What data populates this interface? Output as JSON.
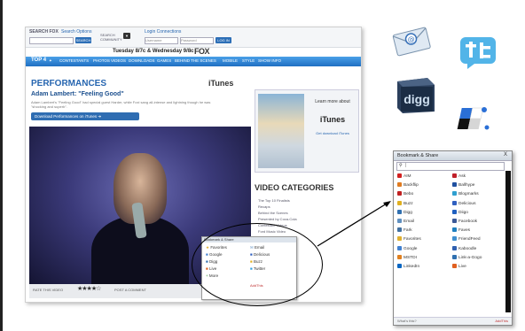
{
  "screenshot": {
    "topbar": {
      "search_label": "SEARCH FOX",
      "search_sub": "Search Options",
      "search_btn": "SEARCH",
      "community_label": "SEARCH COMMUNITY",
      "login_label": "Login Connections",
      "username_placeholder": "Username",
      "password_placeholder": "Password",
      "login_btn": "LOG IN"
    },
    "date_line": "Tuesday 8/7c & Wednesday 9/8c",
    "network_logo": "FOX",
    "nav": {
      "logo": "TOP 4",
      "items": [
        "CONTESTANTS",
        "PHOTOS",
        "VIDEOS",
        "DOWNLOADS",
        "GAMES",
        "BEHIND THE SCENES",
        "MOBILE",
        "STYLE",
        "SHOW INFO"
      ]
    },
    "section_title": "PERFORMANCES",
    "itunes_header": "iTunes",
    "song_title": "Adam Lambert: \"Feeling Good\"",
    "description": "Adam Lambert's \"Feeling Good\" had special guest Harder, while Foxi sang all-intense and lightning though he was \"shocking and superb\".",
    "download_button": "Download Performances on iTunes",
    "video_controls": {
      "rate_label": "RATE THIS VIDEO",
      "stars": "★★★★☆",
      "post_comment": "POST A COMMENT",
      "share": "SHARE THIS"
    },
    "ad": {
      "learn_more": "Learn more about",
      "itunes": "iTunes",
      "download": "Get download iTunes"
    },
    "video_categories_title": "VIDEO CATEGORIES",
    "video_categories": [
      "The Top 10 Finalists",
      "Recaps",
      "Behind the Scenes",
      "Presented by Coca-Cola",
      "Contestant Videos",
      "Ford Music Video",
      "Audition",
      "The Remaining Top 13",
      "Top 36 Semi-Finals"
    ],
    "mini_menu": {
      "header": "Bookmark & Share",
      "items": [
        "Favorites",
        "Email",
        "Google",
        "Delicious",
        "Digg",
        "Buzz",
        "Live",
        "Twitter",
        "More"
      ],
      "footer": "AddThis"
    }
  },
  "bookmark_panel": {
    "title": "Bookmark & Share",
    "close": "X",
    "search_value": "",
    "items": [
      {
        "label": "AIM",
        "color": "#d12020"
      },
      {
        "label": "Ask",
        "color": "#c0202a"
      },
      {
        "label": "Backflip",
        "color": "#e07b20"
      },
      {
        "label": "Ballhype",
        "color": "#2050a0"
      },
      {
        "label": "Bebo",
        "color": "#c02020"
      },
      {
        "label": "Blogmarks",
        "color": "#30a0d0"
      },
      {
        "label": "Buzz",
        "color": "#e0b020"
      },
      {
        "label": "Delicious",
        "color": "#3060c0"
      },
      {
        "label": "Digg",
        "color": "#3070b0"
      },
      {
        "label": "Diigo",
        "color": "#2060c0"
      },
      {
        "label": "Email",
        "color": "#6090c0"
      },
      {
        "label": "Facebook",
        "color": "#3b5998"
      },
      {
        "label": "Fark",
        "color": "#4070a0"
      },
      {
        "label": "Faves",
        "color": "#2080c0"
      },
      {
        "label": "Favorites",
        "color": "#e0b030"
      },
      {
        "label": "FriendFeed",
        "color": "#4090d0"
      },
      {
        "label": "Google",
        "color": "#4080d0"
      },
      {
        "label": "Kaboodle",
        "color": "#3060b0"
      },
      {
        "label": "MSTDI",
        "color": "#e08020"
      },
      {
        "label": "Link-a-Gogo",
        "color": "#3070b0"
      },
      {
        "label": "LinkedIn",
        "color": "#0a66c2"
      },
      {
        "label": "Live",
        "color": "#e06020"
      }
    ],
    "footer_left": "What's this?",
    "footer_right": "AddThis"
  },
  "icons": [
    "email-icon",
    "twitter-icon",
    "digg-icon",
    "delicious-icon"
  ]
}
